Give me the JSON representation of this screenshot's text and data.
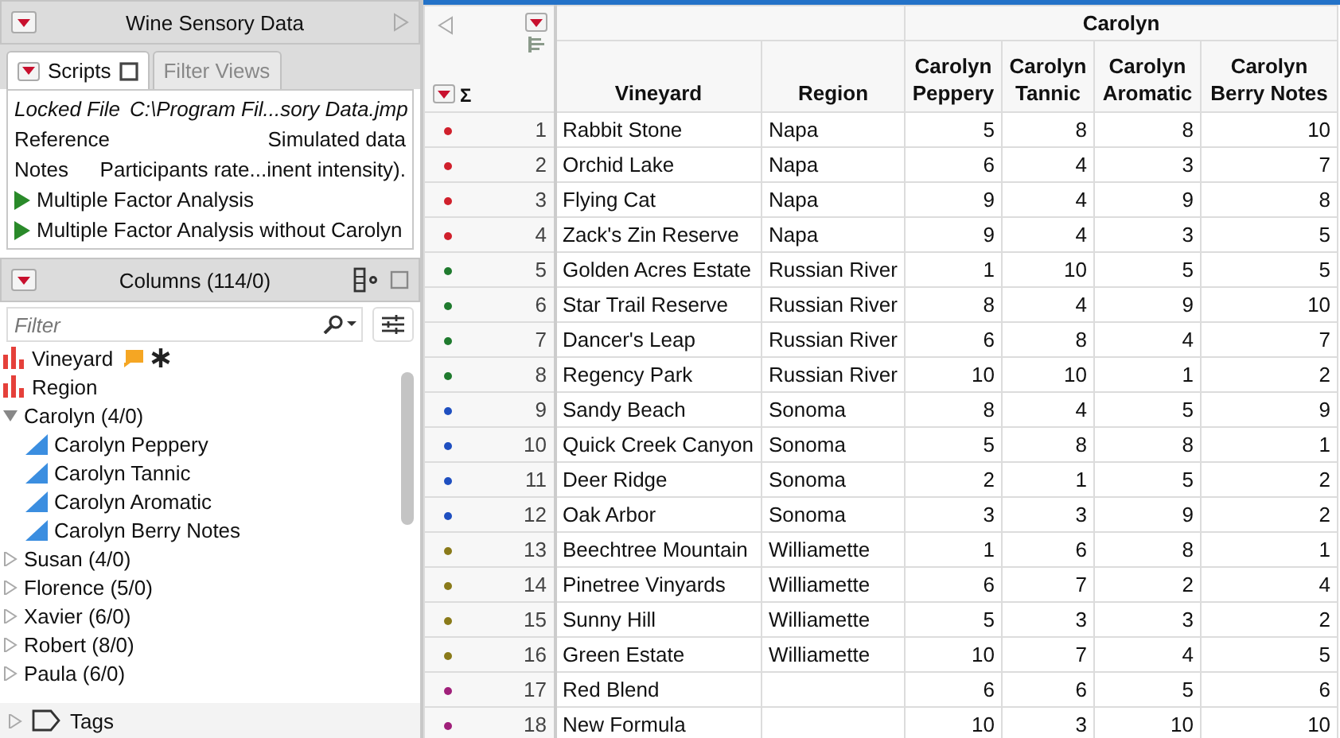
{
  "window": {
    "title": "Wine Sensory Data"
  },
  "tabs": [
    {
      "label": "Scripts",
      "selected": true
    },
    {
      "label": "Filter Views",
      "selected": false
    }
  ],
  "table_info": [
    {
      "kind": "property",
      "label": "Locked File",
      "value": "C:\\Program Fil...sory Data.jmp"
    },
    {
      "kind": "property",
      "label": "Reference",
      "value": "Simulated data"
    },
    {
      "kind": "property",
      "label": "Notes",
      "value": "Participants rate...inent intensity)."
    },
    {
      "kind": "script",
      "label": "Multiple Factor Analysis"
    },
    {
      "kind": "script",
      "label": "Multiple Factor Analysis without Carolyn"
    }
  ],
  "columns_panel": {
    "title": "Columns (114/0)",
    "filter": {
      "placeholder": "Filter"
    },
    "items": [
      {
        "kind": "nominal",
        "label": "Vineyard",
        "labeled": true,
        "tags": true
      },
      {
        "kind": "nominal",
        "label": "Region"
      },
      {
        "kind": "group",
        "label": "Carolyn (4/0)",
        "expanded": true,
        "children": [
          {
            "kind": "continuous",
            "label": "Carolyn Peppery"
          },
          {
            "kind": "continuous",
            "label": "Carolyn Tannic"
          },
          {
            "kind": "continuous",
            "label": "Carolyn Aromatic"
          },
          {
            "kind": "continuous",
            "label": "Carolyn Berry Notes"
          }
        ]
      },
      {
        "kind": "group",
        "label": "Susan (4/0)",
        "expanded": false
      },
      {
        "kind": "group",
        "label": "Florence (5/0)",
        "expanded": false
      },
      {
        "kind": "group",
        "label": "Xavier (6/0)",
        "expanded": false
      },
      {
        "kind": "group",
        "label": "Robert (8/0)",
        "expanded": false
      },
      {
        "kind": "group",
        "label": "Paula (6/0)",
        "expanded": false
      }
    ]
  },
  "tags_section": {
    "label": "Tags",
    "expanded": false
  },
  "table": {
    "corner_symbol": "Σ",
    "group_header": "Carolyn",
    "columns": [
      "Vineyard",
      "Region",
      "Carolyn Peppery",
      "Carolyn Tannic",
      "Carolyn Aromatic",
      "Carolyn Berry Notes"
    ],
    "rows": [
      {
        "n": "1",
        "color": "#d0202c",
        "cells": [
          "Rabbit Stone",
          "Napa",
          "5",
          "8",
          "8",
          "10"
        ]
      },
      {
        "n": "2",
        "color": "#d0202c",
        "cells": [
          "Orchid Lake",
          "Napa",
          "6",
          "4",
          "3",
          "7"
        ]
      },
      {
        "n": "3",
        "color": "#d0202c",
        "cells": [
          "Flying Cat",
          "Napa",
          "9",
          "4",
          "9",
          "8"
        ]
      },
      {
        "n": "4",
        "color": "#d0202c",
        "cells": [
          "Zack's Zin Reserve",
          "Napa",
          "9",
          "4",
          "3",
          "5"
        ]
      },
      {
        "n": "5",
        "color": "#1f7a2e",
        "cells": [
          "Golden Acres Estate",
          "Russian River",
          "1",
          "10",
          "5",
          "5"
        ]
      },
      {
        "n": "6",
        "color": "#1f7a2e",
        "cells": [
          "Star Trail Reserve",
          "Russian River",
          "8",
          "4",
          "9",
          "10"
        ]
      },
      {
        "n": "7",
        "color": "#1f7a2e",
        "cells": [
          "Dancer's Leap",
          "Russian River",
          "6",
          "8",
          "4",
          "7"
        ]
      },
      {
        "n": "8",
        "color": "#1f7a2e",
        "cells": [
          "Regency Park",
          "Russian River",
          "10",
          "10",
          "1",
          "2"
        ]
      },
      {
        "n": "9",
        "color": "#1f4fc0",
        "cells": [
          "Sandy Beach",
          "Sonoma",
          "8",
          "4",
          "5",
          "9"
        ]
      },
      {
        "n": "10",
        "color": "#1f4fc0",
        "cells": [
          "Quick Creek Canyon",
          "Sonoma",
          "5",
          "8",
          "8",
          "1"
        ]
      },
      {
        "n": "11",
        "color": "#1f4fc0",
        "cells": [
          "Deer Ridge",
          "Sonoma",
          "2",
          "1",
          "5",
          "2"
        ]
      },
      {
        "n": "12",
        "color": "#1f4fc0",
        "cells": [
          "Oak Arbor",
          "Sonoma",
          "3",
          "3",
          "9",
          "2"
        ]
      },
      {
        "n": "13",
        "color": "#8a7a1a",
        "cells": [
          "Beechtree Mountain",
          "Williamette",
          "1",
          "6",
          "8",
          "1"
        ]
      },
      {
        "n": "14",
        "color": "#8a7a1a",
        "cells": [
          "Pinetree Vinyards",
          "Williamette",
          "6",
          "7",
          "2",
          "4"
        ]
      },
      {
        "n": "15",
        "color": "#8a7a1a",
        "cells": [
          "Sunny Hill",
          "Williamette",
          "5",
          "3",
          "3",
          "2"
        ]
      },
      {
        "n": "16",
        "color": "#8a7a1a",
        "cells": [
          "Green Estate",
          "Williamette",
          "10",
          "7",
          "4",
          "5"
        ]
      },
      {
        "n": "17",
        "color": "#a0207a",
        "cells": [
          "Red Blend",
          "",
          "6",
          "6",
          "5",
          "6"
        ]
      },
      {
        "n": "18",
        "color": "#a0207a",
        "cells": [
          "New Formula",
          "",
          "10",
          "3",
          "10",
          "10"
        ]
      }
    ]
  }
}
